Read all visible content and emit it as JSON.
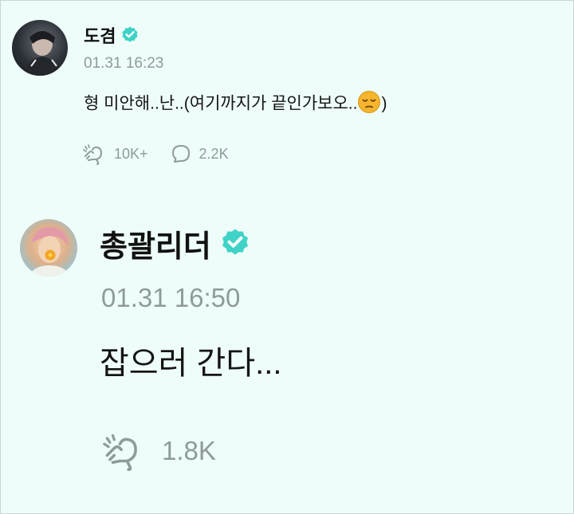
{
  "posts": [
    {
      "author": "도겸",
      "verified": true,
      "timestamp": "01.31 16:23",
      "message_before_emoji": "형 미안해..난..(여기까지가 끝인가보오..",
      "emoji": "pensive-face",
      "message_after_emoji": ")",
      "likes": "10K+",
      "comments": "2.2K"
    },
    {
      "author": "총괄리더",
      "verified": true,
      "timestamp": "01.31 16:50",
      "message": "잡으러 간다...",
      "likes": "1.8K"
    }
  ],
  "colors": {
    "background": "#eefdfa",
    "verified_badge": "#3fd2c7",
    "meta_gray": "#8f9a99"
  }
}
